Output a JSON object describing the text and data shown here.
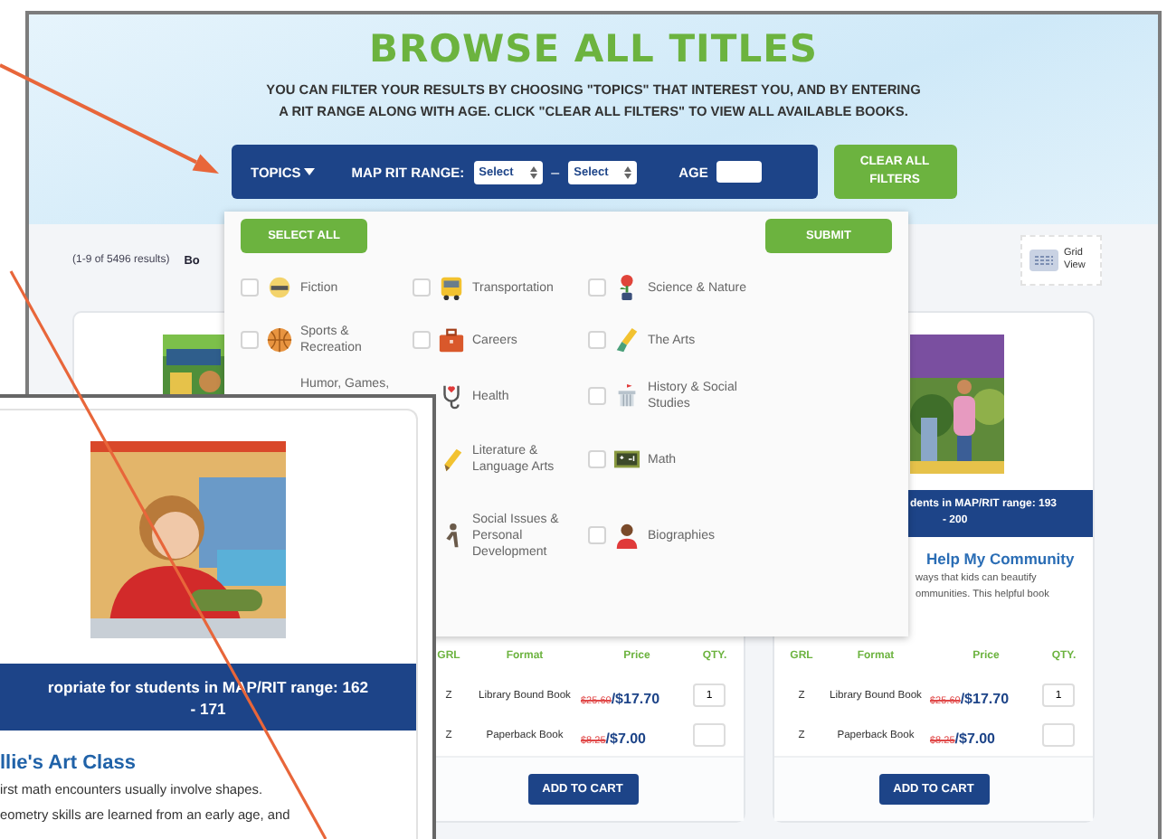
{
  "header": {
    "title": "BROWSE ALL TITLES",
    "description": "YOU CAN FILTER YOUR RESULTS BY CHOOSING \"TOPICS\" THAT INTEREST YOU, AND BY ENTERING A RIT RANGE ALONG WITH AGE. CLICK \"CLEAR ALL FILTERS\" TO VIEW ALL AVAILABLE BOOKS."
  },
  "filter_bar": {
    "topics": "TOPICS",
    "rit_label": "MAP RIT RANGE:",
    "rit_from": "Select",
    "separator": "–",
    "rit_to": "Select",
    "age_label": "AGE",
    "clear_button": "CLEAR ALL FILTERS"
  },
  "results": {
    "count": "(1-9 of 5496 results)",
    "sort_label": "Bo",
    "view_button": "Grid View"
  },
  "topics_menu": {
    "select_all": "SELECT ALL",
    "submit": "SUBMIT",
    "columns": [
      [
        {
          "label": "Fiction",
          "checked": false
        },
        {
          "label": "Sports & Recreation",
          "checked": false
        },
        {
          "label": "Humor, Games,"
        }
      ],
      [
        {
          "label": "Transportation",
          "checked": false
        },
        {
          "label": "Careers",
          "checked": false
        },
        {
          "label": "Health"
        },
        {
          "label": "Literature & Language Arts"
        },
        {
          "label": "Social Issues & Personal Development"
        }
      ],
      [
        {
          "label": "Science & Nature",
          "checked": false
        },
        {
          "label": "The Arts",
          "checked": false
        },
        {
          "label": "History & Social Studies",
          "checked": false
        },
        {
          "label": "Math",
          "checked": false
        },
        {
          "label": "Biographies",
          "checked": false
        }
      ]
    ]
  },
  "cards": [
    {
      "cover": {
        "kind": "picture"
      }
    },
    {
      "formats": {
        "columns": [
          "GRL",
          "Format",
          "Price",
          "QTY."
        ],
        "rows": [
          {
            "grl": "Z",
            "format": "Library Bound Book",
            "list_price": "$25.60",
            "price": "/$17.70",
            "qty": "1"
          },
          {
            "grl": "Z",
            "format": "Paperback Book",
            "list_price": "$8.25",
            "price": "/$7.00"
          }
        ]
      },
      "button": "ADD TO CART"
    },
    {
      "cover": {
        "kind": "picture"
      },
      "range": [
        "dents in MAP/RIT range: 193",
        "- 200"
      ],
      "title": "Help My Community",
      "description": [
        "ways that kids can beautify",
        "ommunities. This helpful book"
      ],
      "formats": {
        "columns": [
          "GRL",
          "Format",
          "Price",
          "QTY."
        ],
        "rows": [
          {
            "grl": "Z",
            "format": "Library Bound Book",
            "list_price": "$25.60",
            "price": "/$17.70",
            "qty": "1"
          },
          {
            "grl": "Z",
            "format": "Paperback Book",
            "list_price": "$8.25",
            "price": "/$7.00"
          }
        ]
      },
      "button": "ADD TO CART"
    }
  ],
  "inset": {
    "cover": {
      "kind": "picture"
    },
    "range": [
      "ropriate for students in MAP/RIT range: 162",
      "- 171"
    ],
    "title": "llie's Art Class",
    "description": [
      "irst math encounters usually involve shapes.",
      "eometry skills are learned from an early age, and"
    ]
  }
}
